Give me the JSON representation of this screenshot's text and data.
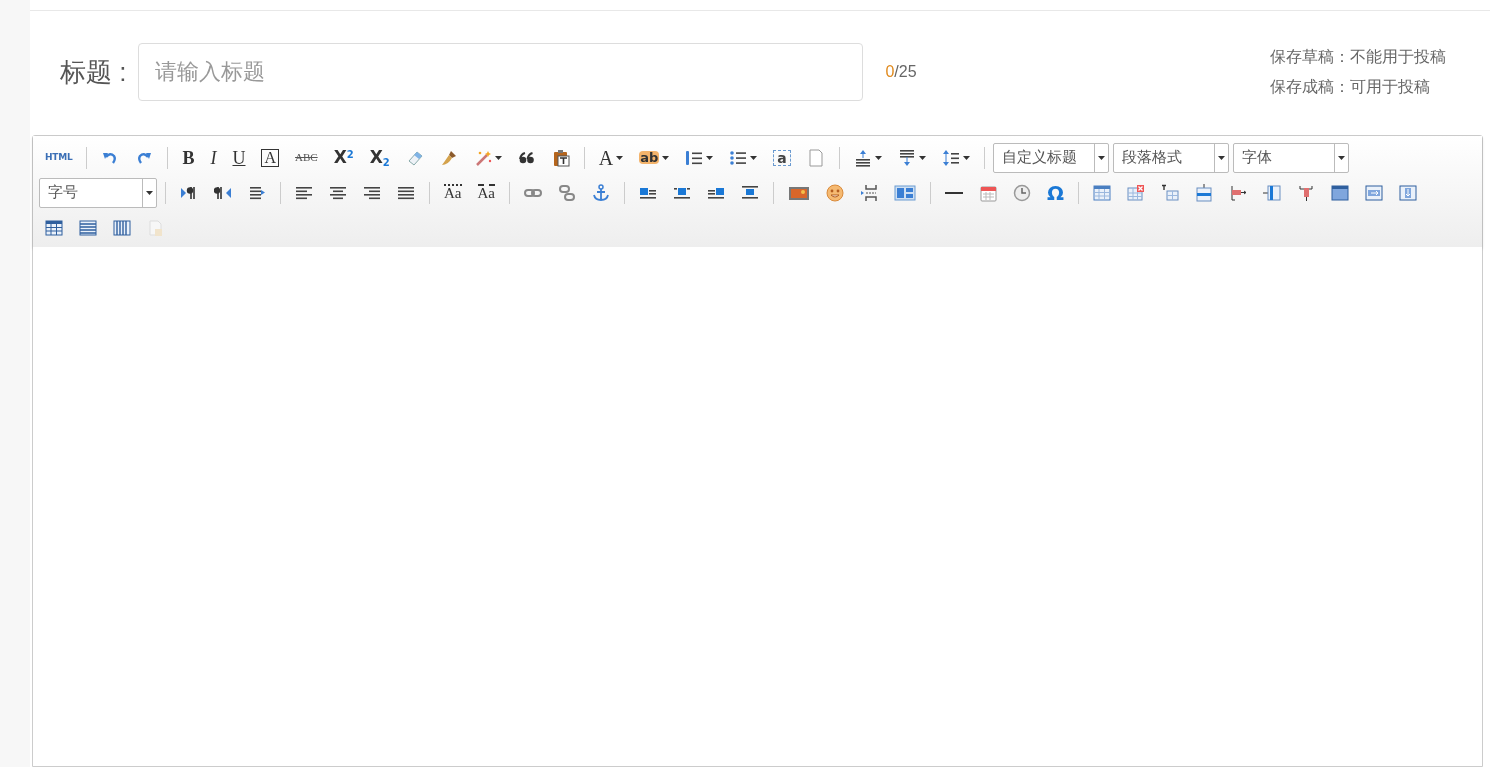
{
  "title_label": "标题 :",
  "title_field": {
    "placeholder": "请输入标题"
  },
  "counter": {
    "current": "0",
    "limit": "/25"
  },
  "notes": [
    "保存草稿：不能用于投稿",
    "保存成稿：可用于投稿"
  ],
  "toolbar": {
    "glyphs": [
      "HTML",
      "B",
      "I",
      "U",
      "A",
      "ABC",
      "X$^{2}$",
      "X$_{2}$",
      "A",
      "ab",
      "a",
      "Aa",
      "Aa",
      "Ω"
    ],
    "selects": [
      {
        "label": "自定义标题"
      },
      {
        "label": "段落格式"
      },
      {
        "label": "字体"
      },
      {
        "label": "字号"
      }
    ]
  }
}
